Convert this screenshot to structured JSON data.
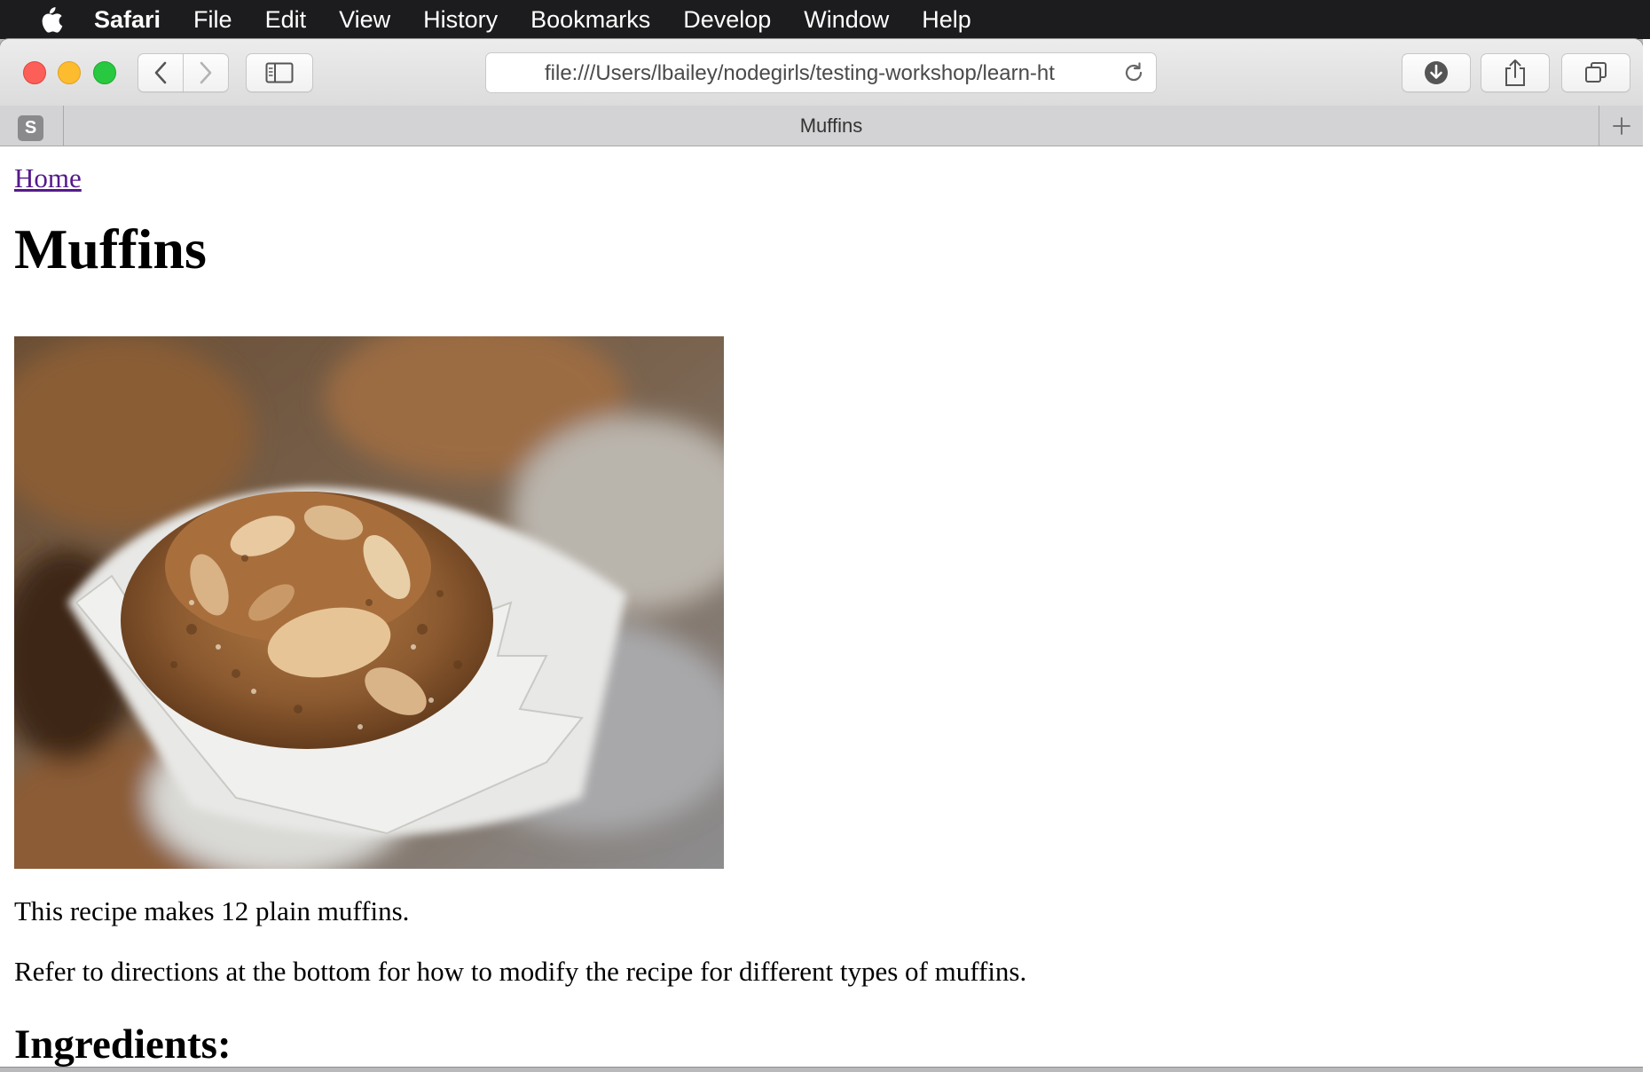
{
  "menubar": {
    "app": "Safari",
    "items": [
      "File",
      "Edit",
      "View",
      "History",
      "Bookmarks",
      "Develop",
      "Window",
      "Help"
    ]
  },
  "toolbar": {
    "url": "file:///Users/lbailey/nodegirls/testing-workshop/learn-ht"
  },
  "tab": {
    "favicon_letter": "S",
    "title": "Muffins"
  },
  "page": {
    "home_link": "Home",
    "heading": "Muffins",
    "intro": "This recipe makes 12 plain muffins.",
    "directions_note": "Refer to directions at the bottom for how to modify the recipe for different types of muffins.",
    "ingredients_heading": "Ingredients:"
  },
  "colors": {
    "menubar_bg": "#1c1c1e",
    "link_visited": "#551a8b",
    "close": "#fc5f57",
    "minimize": "#fdbc2e",
    "maximize": "#28c840"
  },
  "icons": {
    "apple": "apple-logo-icon",
    "back": "chevron-left-icon",
    "forward": "chevron-right-icon",
    "sidebar": "sidebar-icon",
    "reload": "reload-icon",
    "download": "download-icon",
    "share": "share-icon",
    "tabs": "tabs-overview-icon",
    "new_tab": "plus-icon"
  }
}
